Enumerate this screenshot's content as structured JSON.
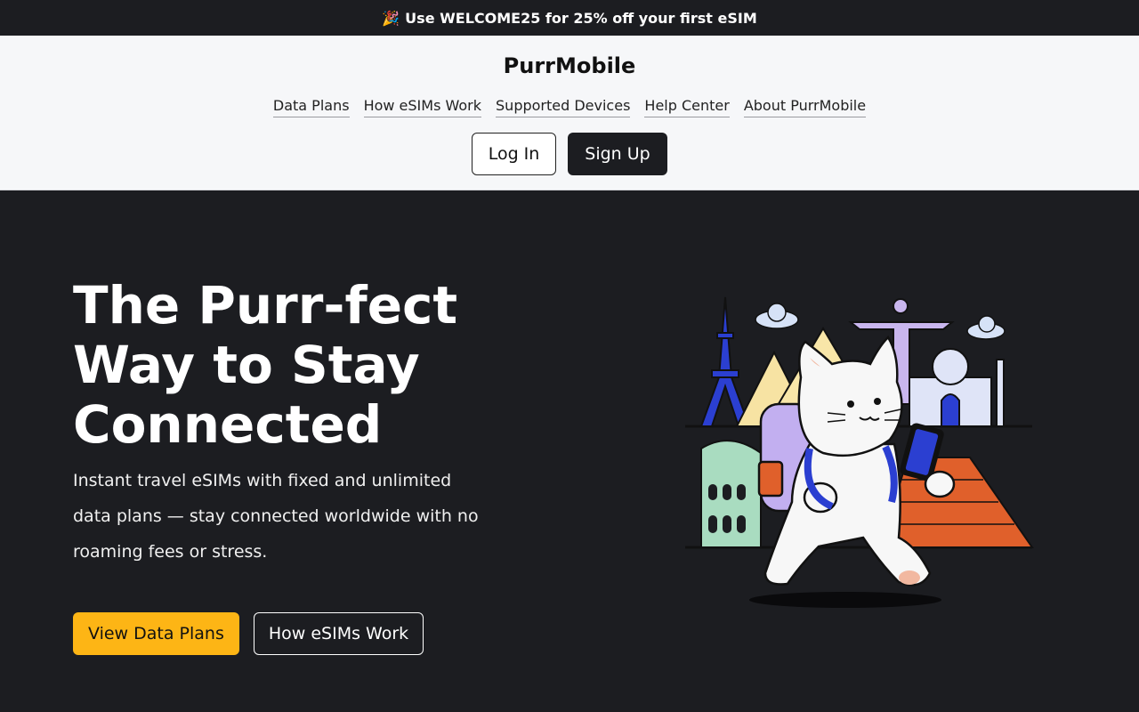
{
  "promo": {
    "icon": "party-popper-icon",
    "emoji": "🎉",
    "text": "Use WELCOME25 for 25% off your first eSIM"
  },
  "header": {
    "brand": "PurrMobile",
    "nav": [
      "Data Plans",
      "How eSIMs Work",
      "Supported Devices",
      "Help Center",
      "About PurrMobile"
    ],
    "login_label": "Log In",
    "signup_label": "Sign Up"
  },
  "hero": {
    "title": "The Purr-fect Way to Stay Connected",
    "subtitle": "Instant travel eSIMs with fixed and unlimited data plans — stay connected worldwide with no roaming fees or stress.",
    "primary_cta": "View Data Plans",
    "secondary_cta": "How eSIMs Work",
    "illustration": "traveling-cat-landmarks-illustration"
  },
  "colors": {
    "accent": "#fdb515",
    "dark": "#1c1d21",
    "header_bg": "#f6f7f9"
  }
}
